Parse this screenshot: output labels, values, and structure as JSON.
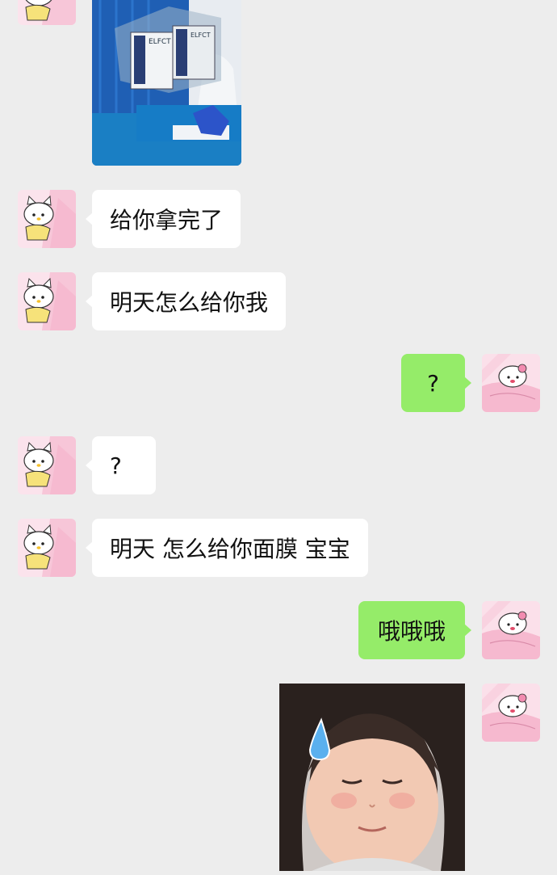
{
  "messages": [
    {
      "side": "in",
      "type": "image",
      "description_icon": "product-box-photo"
    },
    {
      "side": "in",
      "type": "text",
      "text": "给你拿完了"
    },
    {
      "side": "in",
      "type": "text",
      "text": "明天怎么给你我"
    },
    {
      "side": "out",
      "type": "text",
      "text": "?"
    },
    {
      "side": "in",
      "type": "text",
      "text": "?"
    },
    {
      "side": "in",
      "type": "text",
      "text": "明天 怎么给你面膜 宝宝"
    },
    {
      "side": "out",
      "type": "text",
      "text": "哦哦哦"
    },
    {
      "side": "out",
      "type": "sticker",
      "description_icon": "girl-sweat-sticker"
    }
  ],
  "box_label": {
    "line1": "ELFCT"
  },
  "colors": {
    "background": "#ededed",
    "incoming_bubble": "#ffffff",
    "outgoing_bubble": "#95ec69"
  }
}
